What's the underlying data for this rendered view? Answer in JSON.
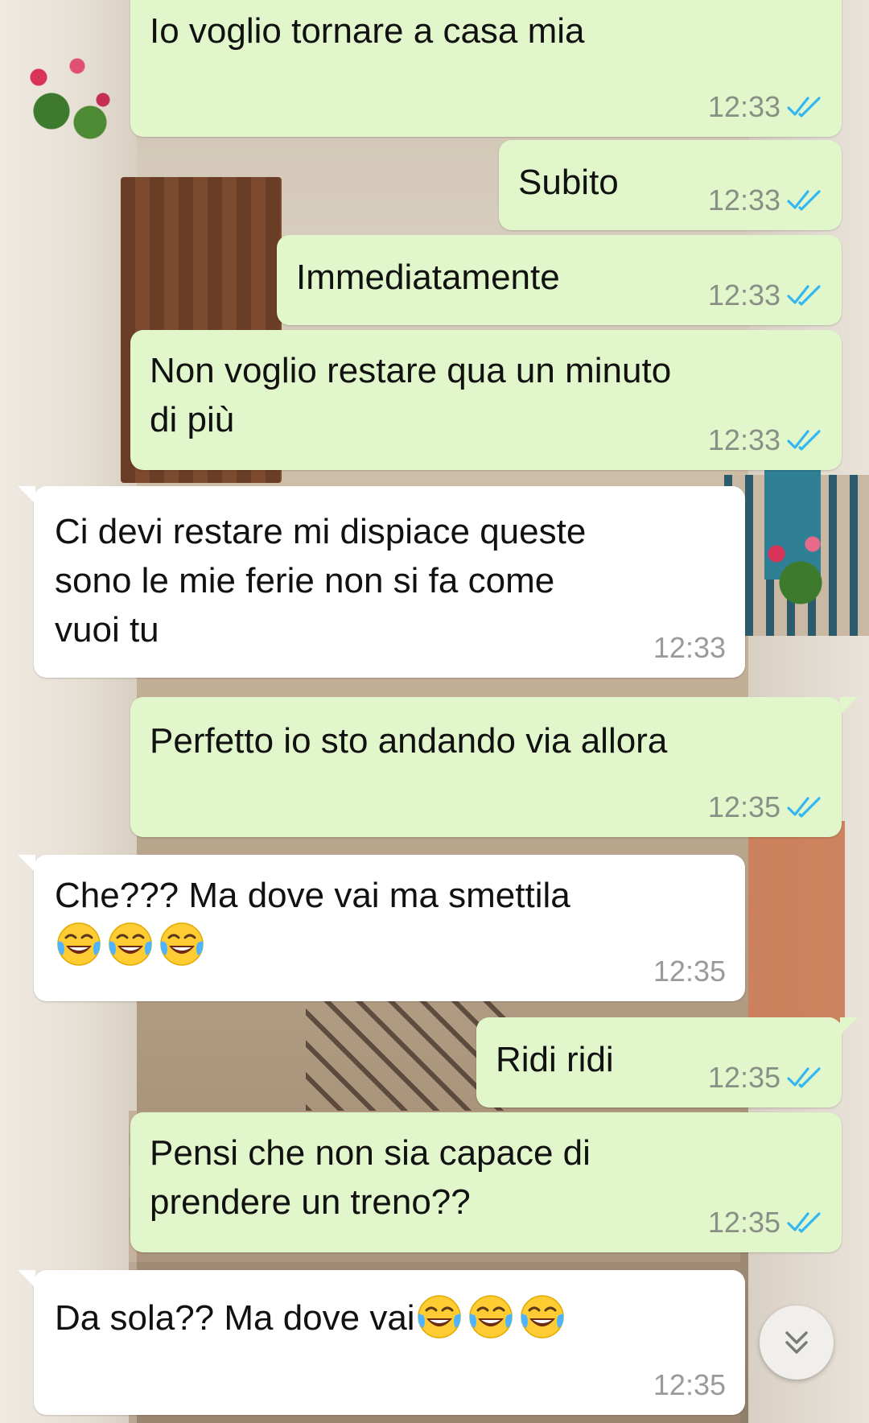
{
  "messages": [
    {
      "direction": "outgoing",
      "text": "Io voglio tornare a casa mia",
      "time": "12:33",
      "status": "read"
    },
    {
      "direction": "outgoing",
      "text": "Subito",
      "time": "12:33",
      "status": "read"
    },
    {
      "direction": "outgoing",
      "text": "Immediatamente",
      "time": "12:33",
      "status": "read"
    },
    {
      "direction": "outgoing",
      "text_line1": "Non voglio restare qua un minuto",
      "text_line2": "di più",
      "time": "12:33",
      "status": "read"
    },
    {
      "direction": "incoming",
      "text_line1": "Ci devi restare mi dispiace queste",
      "text_line2": "sono le mie ferie non si fa come",
      "text_line3": "vuoi tu",
      "time": "12:33"
    },
    {
      "direction": "outgoing",
      "text": "Perfetto io sto andando via allora",
      "time": "12:35",
      "status": "read"
    },
    {
      "direction": "incoming",
      "text": "Che??? Ma dove vai ma smettila",
      "emoji": [
        "face-with-tears-of-joy",
        "face-with-tears-of-joy",
        "face-with-tears-of-joy"
      ],
      "time": "12:35"
    },
    {
      "direction": "outgoing",
      "text": "Ridi ridi",
      "time": "12:35",
      "status": "read"
    },
    {
      "direction": "outgoing",
      "text_line1": "Pensi che non sia capace di",
      "text_line2": "prendere un treno??",
      "time": "12:35",
      "status": "read"
    },
    {
      "direction": "incoming",
      "text": "Da sola?? Ma dove vai",
      "emoji": [
        "face-with-tears-of-joy",
        "face-with-tears-of-joy",
        "face-with-tears-of-joy"
      ],
      "time": "12:35"
    }
  ],
  "icons": {
    "read_ticks": "double-check-icon",
    "scroll_down": "double-chevron-down-icon"
  },
  "colors": {
    "outgoing_bubble": "#e1f7cb",
    "incoming_bubble": "#ffffff",
    "read_ticks": "#34b7f1",
    "time_text": "#8a8f86"
  }
}
